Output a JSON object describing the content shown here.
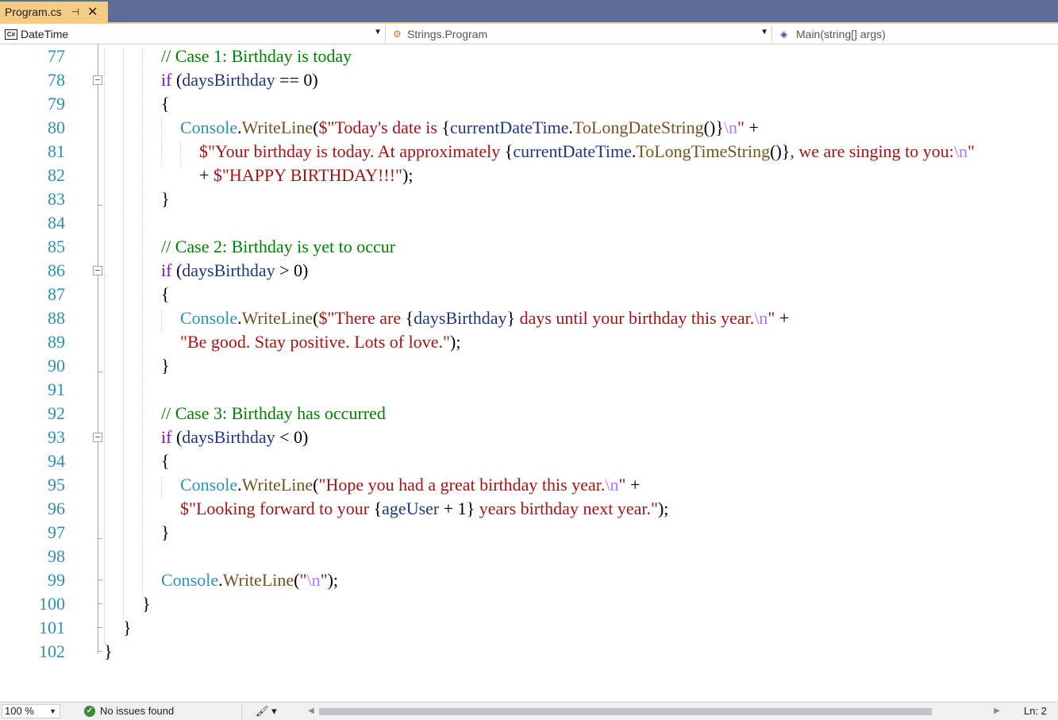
{
  "tab": {
    "label": "Program.cs",
    "pin_glyph": "⊣",
    "close_glyph": "✕"
  },
  "navbar": {
    "project": "DateTime",
    "type": "Strings.Program",
    "member": "Main(string[] args)"
  },
  "editor": {
    "lines": [
      {
        "n": "77",
        "indent": 203,
        "tokens": [
          [
            "cm",
            "// Case 1: Birthday is today"
          ]
        ]
      },
      {
        "n": "78",
        "indent": 203,
        "fold": true,
        "tokens": [
          [
            "kw",
            "if"
          ],
          [
            "",
            " ("
          ],
          [
            "vr",
            "daysBirthday"
          ],
          [
            "",
            " == 0)"
          ]
        ]
      },
      {
        "n": "79",
        "indent": 203,
        "tokens": [
          [
            "",
            "{"
          ]
        ]
      },
      {
        "n": "80",
        "indent": 227,
        "tokens": [
          [
            "tp",
            "Console"
          ],
          [
            "",
            "."
          ],
          [
            "mt",
            "WriteLine"
          ],
          [
            "",
            "("
          ],
          [
            "st",
            "$\"Today's date is "
          ],
          [
            "",
            "{"
          ],
          [
            "vr",
            "currentDateTime"
          ],
          [
            "",
            "."
          ],
          [
            "mt",
            "ToLongDateString"
          ],
          [
            "",
            "()}"
          ],
          [
            "esc",
            "\\n"
          ],
          [
            "st",
            "\""
          ],
          [
            "",
            " +"
          ]
        ]
      },
      {
        "n": "81",
        "indent": 251,
        "tokens": [
          [
            "st",
            "$\"Your birthday is today. At approximately "
          ],
          [
            "",
            "{"
          ],
          [
            "vr",
            "currentDateTime"
          ],
          [
            "",
            "."
          ],
          [
            "mt",
            "ToLongTimeString"
          ],
          [
            "",
            "()}"
          ],
          [
            "st",
            ", we are singing to you:"
          ],
          [
            "esc",
            "\\n"
          ],
          [
            "st",
            "\""
          ]
        ]
      },
      {
        "n": "82",
        "indent": 251,
        "tokens": [
          [
            "",
            "+ "
          ],
          [
            "st",
            "$\"HAPPY BIRTHDAY!!!\""
          ],
          [
            "",
            ");"
          ]
        ]
      },
      {
        "n": "83",
        "indent": 203,
        "tokens": [
          [
            "",
            "}"
          ]
        ]
      },
      {
        "n": "84",
        "indent": 203,
        "tokens": []
      },
      {
        "n": "85",
        "indent": 203,
        "tokens": [
          [
            "cm",
            "// Case 2: Birthday is yet to occur"
          ]
        ]
      },
      {
        "n": "86",
        "indent": 203,
        "fold": true,
        "tokens": [
          [
            "kw",
            "if"
          ],
          [
            "",
            " ("
          ],
          [
            "vr",
            "daysBirthday"
          ],
          [
            "",
            " > 0)"
          ]
        ]
      },
      {
        "n": "87",
        "indent": 203,
        "tokens": [
          [
            "",
            "{"
          ]
        ]
      },
      {
        "n": "88",
        "indent": 227,
        "tokens": [
          [
            "tp",
            "Console"
          ],
          [
            "",
            "."
          ],
          [
            "mt",
            "WriteLine"
          ],
          [
            "",
            "("
          ],
          [
            "st",
            "$\"There are "
          ],
          [
            "",
            "{"
          ],
          [
            "vr",
            "daysBirthday"
          ],
          [
            "",
            "}"
          ],
          [
            "st",
            " days until your birthday this year."
          ],
          [
            "esc",
            "\\n"
          ],
          [
            "st",
            "\""
          ],
          [
            "",
            " +"
          ]
        ]
      },
      {
        "n": "89",
        "indent": 227,
        "tokens": [
          [
            "st",
            "\"Be good. Stay positive. Lots of love.\""
          ],
          [
            "",
            ");"
          ]
        ]
      },
      {
        "n": "90",
        "indent": 203,
        "tokens": [
          [
            "",
            "}"
          ]
        ]
      },
      {
        "n": "91",
        "indent": 203,
        "tokens": []
      },
      {
        "n": "92",
        "indent": 203,
        "tokens": [
          [
            "cm",
            "// Case 3: Birthday has occurred"
          ]
        ]
      },
      {
        "n": "93",
        "indent": 203,
        "fold": true,
        "tokens": [
          [
            "kw",
            "if"
          ],
          [
            "",
            " ("
          ],
          [
            "vr",
            "daysBirthday"
          ],
          [
            "",
            " < 0)"
          ]
        ]
      },
      {
        "n": "94",
        "indent": 203,
        "tokens": [
          [
            "",
            "{"
          ]
        ]
      },
      {
        "n": "95",
        "indent": 227,
        "tokens": [
          [
            "tp",
            "Console"
          ],
          [
            "",
            "."
          ],
          [
            "mt",
            "WriteLine"
          ],
          [
            "",
            "("
          ],
          [
            "st",
            "\"Hope you had a great birthday this year."
          ],
          [
            "esc",
            "\\n"
          ],
          [
            "st",
            "\""
          ],
          [
            "",
            " +"
          ]
        ]
      },
      {
        "n": "96",
        "indent": 227,
        "tokens": [
          [
            "st",
            "$\"Looking forward to your "
          ],
          [
            "",
            "{"
          ],
          [
            "vr",
            "ageUser"
          ],
          [
            "",
            " + 1}"
          ],
          [
            "st",
            " years birthday next year.\""
          ],
          [
            "",
            ");"
          ]
        ]
      },
      {
        "n": "97",
        "indent": 203,
        "tokens": [
          [
            "",
            "}"
          ]
        ]
      },
      {
        "n": "98",
        "indent": 203,
        "tokens": []
      },
      {
        "n": "99",
        "indent": 203,
        "tokens": [
          [
            "tp",
            "Console"
          ],
          [
            "",
            "."
          ],
          [
            "mt",
            "WriteLine"
          ],
          [
            "",
            "("
          ],
          [
            "st",
            "\""
          ],
          [
            "esc",
            "\\n"
          ],
          [
            "st",
            "\""
          ],
          [
            "",
            ");"
          ]
        ]
      },
      {
        "n": "100",
        "indent": 179,
        "tokens": [
          [
            "",
            "}"
          ]
        ]
      },
      {
        "n": "101",
        "indent": 155,
        "tokens": [
          [
            "",
            "}"
          ]
        ]
      },
      {
        "n": "102",
        "indent": 131,
        "tokens": [
          [
            "",
            "}"
          ]
        ]
      }
    ]
  },
  "statusbar": {
    "zoom": "100 %",
    "issues": "No issues found",
    "position": "Ln: 2"
  },
  "colors": {
    "tabstrip": "#5d6b99",
    "active_tab": "#f5cc84",
    "line_number": "#2b91af",
    "keyword": "#8f08c4",
    "comment": "#008000",
    "string": "#a31515",
    "escape": "#b776fb",
    "type": "#2b91af",
    "method": "#74531f",
    "variable": "#1f377f"
  },
  "icons": {
    "project": "csharp-project-icon",
    "type": "class-icon",
    "member": "method-icon",
    "issues": "check-circle-icon",
    "cleanup": "brush-icon"
  }
}
